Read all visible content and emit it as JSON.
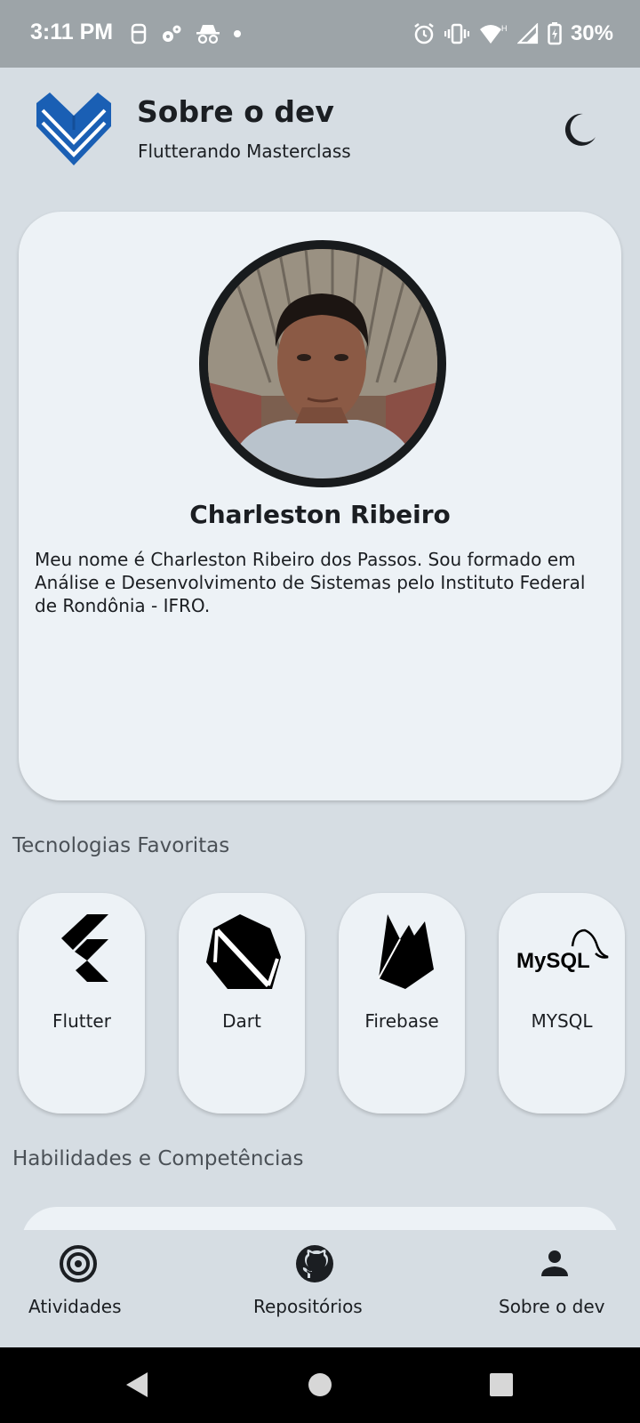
{
  "status_bar": {
    "time": "3:11 PM",
    "battery": "30%",
    "left_icons": [
      "notification-icon",
      "settings-icon",
      "incognito-icon",
      "dot-icon"
    ],
    "right_icons": [
      "alarm-icon",
      "vibrate-icon",
      "wifi-icon",
      "signal-icon",
      "battery-icon"
    ]
  },
  "header": {
    "title": "Sobre o dev",
    "subtitle": "Flutterando Masterclass",
    "logo_icon": "heart-logo-icon",
    "theme_icon": "moon-icon",
    "logo_color": "#1a5fb4"
  },
  "profile": {
    "name": "Charleston Ribeiro",
    "bio": "Meu nome é Charleston Ribeiro dos Passos. Sou formado em Análise e Desenvolvimento de Sistemas pelo Instituto Federal de Rondônia - IFRO."
  },
  "sections": {
    "technologies_title": "Tecnologias Favoritas",
    "skills_title": "Habilidades e Competências"
  },
  "technologies": [
    {
      "label": "Flutter",
      "icon": "flutter-logo-icon"
    },
    {
      "label": "Dart",
      "icon": "dart-logo-icon"
    },
    {
      "label": "Firebase",
      "icon": "firebase-logo-icon"
    },
    {
      "label": "MYSQL",
      "icon": "mysql-logo-icon",
      "logo_text": "MySQL"
    }
  ],
  "bottom_nav": [
    {
      "label": "Atividades",
      "icon": "target-icon"
    },
    {
      "label": "Repositórios",
      "icon": "github-icon"
    },
    {
      "label": "Sobre o dev",
      "icon": "person-icon"
    }
  ],
  "system_nav": [
    "back-icon",
    "home-icon",
    "recents-icon"
  ],
  "colors": {
    "background": "#d6dde3",
    "card": "#edf2f6",
    "status_bar": "#9da4a8",
    "text": "#1b1e22"
  }
}
